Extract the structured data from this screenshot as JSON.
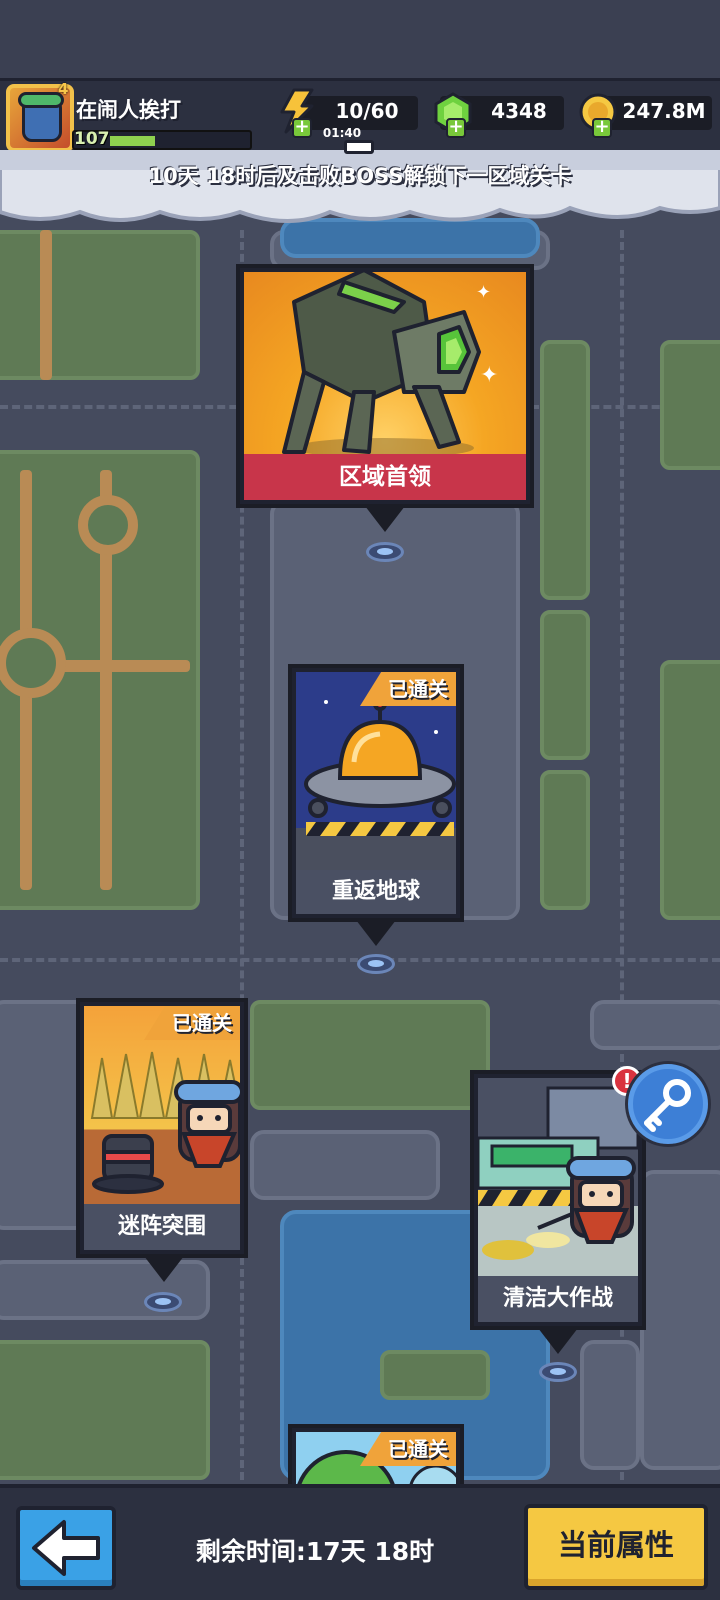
{
  "player": {
    "name": "在闹人挨打",
    "level": "107",
    "badge": "4",
    "xp_fraction": 0.33
  },
  "resources": {
    "energy": {
      "value": "10/60",
      "timer": "01:40",
      "icon": "lightning-icon"
    },
    "gems": {
      "value": "4348",
      "icon": "green-gem-icon"
    },
    "coins": {
      "value": "247.8M",
      "icon": "gold-coin-icon"
    }
  },
  "banner": {
    "unlock_text": "10天 18时后及击败BOSS解锁下一区域关卡"
  },
  "stages": [
    {
      "id": "boss",
      "label": "区域首领",
      "cleared": false,
      "art": "green-mech-robot"
    },
    {
      "id": "return-earth",
      "label": "重返地球",
      "cleared": true,
      "cleared_text": "已通关",
      "art": "ufo-saucer"
    },
    {
      "id": "maze-breakout",
      "label": "迷阵突围",
      "cleared": true,
      "cleared_text": "已通关",
      "art": "cornfield-hero"
    },
    {
      "id": "cleanup",
      "label": "清洁大作战",
      "cleared": false,
      "art": "cleaning-hero",
      "alert": "!"
    },
    {
      "id": "next",
      "label": "",
      "cleared": true,
      "cleared_text": "已通关",
      "art": "tree-sky"
    }
  ],
  "bottom": {
    "time_left": "剩余时间:17天 18时",
    "attributes_label": "当前属性"
  },
  "colors": {
    "boss_label": "#c8354a",
    "cleared_tag": "#f0a33a",
    "attr_button": "#f5c842",
    "back_button": "#3aa1e6"
  }
}
